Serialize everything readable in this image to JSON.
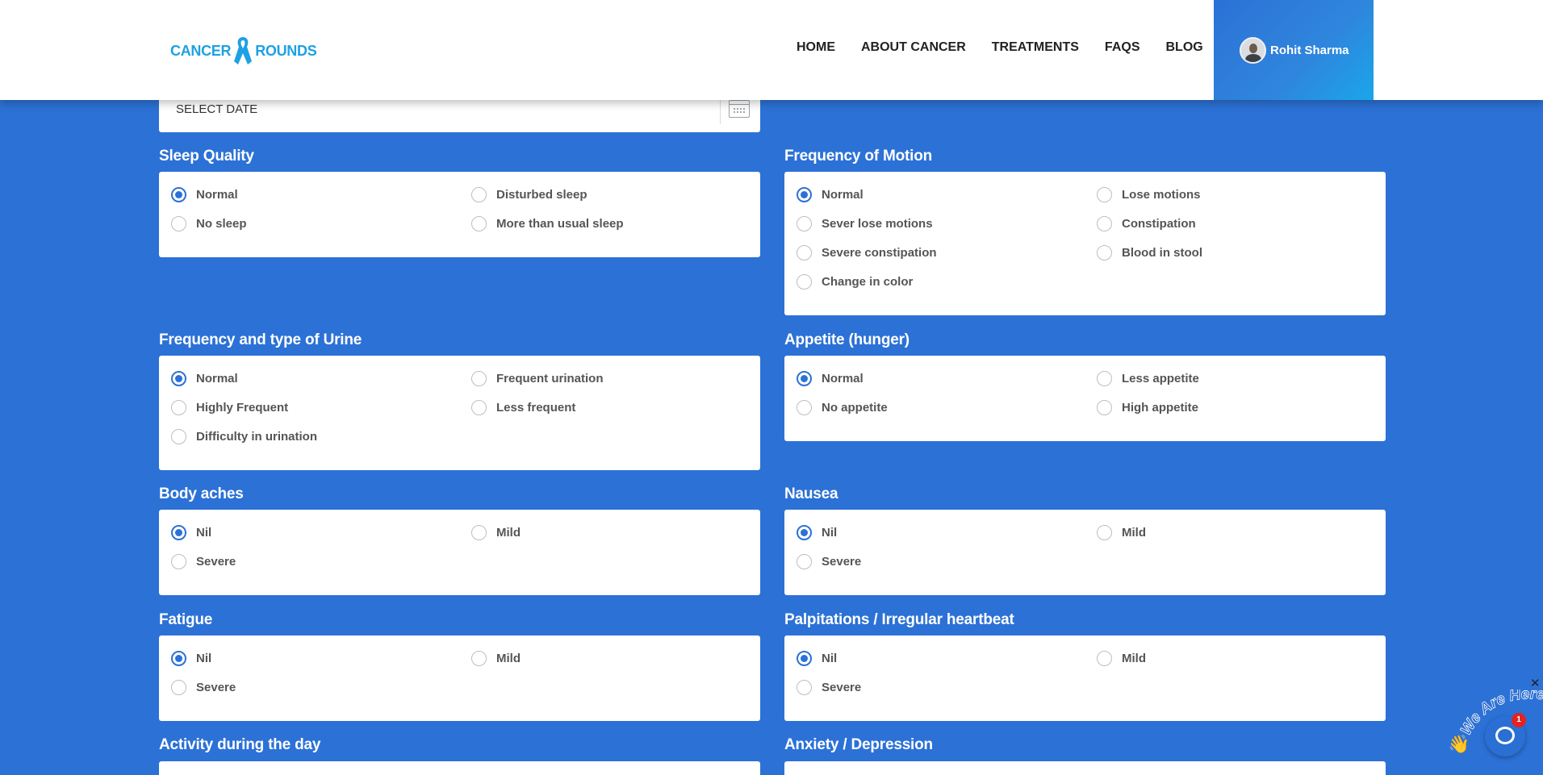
{
  "header": {
    "logo_left": "CANCER",
    "logo_right": "ROUNDS",
    "nav": [
      "HOME",
      "ABOUT CANCER",
      "TREATMENTS",
      "FAQS",
      "BLOG"
    ],
    "user_name": "Rohit Sharma"
  },
  "date": {
    "label": "SELECT DATE",
    "icon": "calendar-icon"
  },
  "sections": {
    "sleep": {
      "title": "Sleep Quality",
      "options": [
        "Normal",
        "Disturbed sleep",
        "No sleep",
        "More than usual sleep"
      ],
      "selected": "Normal"
    },
    "motion": {
      "title": "Frequency of Motion",
      "options": [
        "Normal",
        "Lose motions",
        "Sever lose motions",
        "Constipation",
        "Severe constipation",
        "Blood in stool",
        "Change in color"
      ],
      "selected": "Normal"
    },
    "urine": {
      "title": "Frequency and type of Urine",
      "options": [
        "Normal",
        "Frequent urination",
        "Highly Frequent",
        "Less frequent",
        "Difficulty in urination"
      ],
      "selected": "Normal"
    },
    "appetite": {
      "title": "Appetite (hunger)",
      "options": [
        "Normal",
        "Less appetite",
        "No appetite",
        "High appetite"
      ],
      "selected": "Normal"
    },
    "body_aches": {
      "title": "Body aches",
      "options": [
        "Nil",
        "Mild",
        "Severe"
      ],
      "selected": "Nil"
    },
    "nausea": {
      "title": "Nausea",
      "options": [
        "Nil",
        "Mild",
        "Severe"
      ],
      "selected": "Nil"
    },
    "fatigue": {
      "title": "Fatigue",
      "options": [
        "Nil",
        "Mild",
        "Severe"
      ],
      "selected": "Nil"
    },
    "palpitations": {
      "title": "Palpitations / Irregular heartbeat",
      "options": [
        "Nil",
        "Mild",
        "Severe"
      ],
      "selected": "Nil"
    },
    "activity": {
      "title": "Activity during the day"
    },
    "anxiety": {
      "title": "Anxiety / Depression"
    }
  },
  "chat": {
    "tagline": "We Are Here!",
    "badge_count": "1",
    "close_symbol": "✕",
    "hand": "👋"
  },
  "colors": {
    "background": "#2c71d6",
    "logo": "#1da1e3",
    "radio_checked": "#2c71d6",
    "badge": "#e02424"
  }
}
